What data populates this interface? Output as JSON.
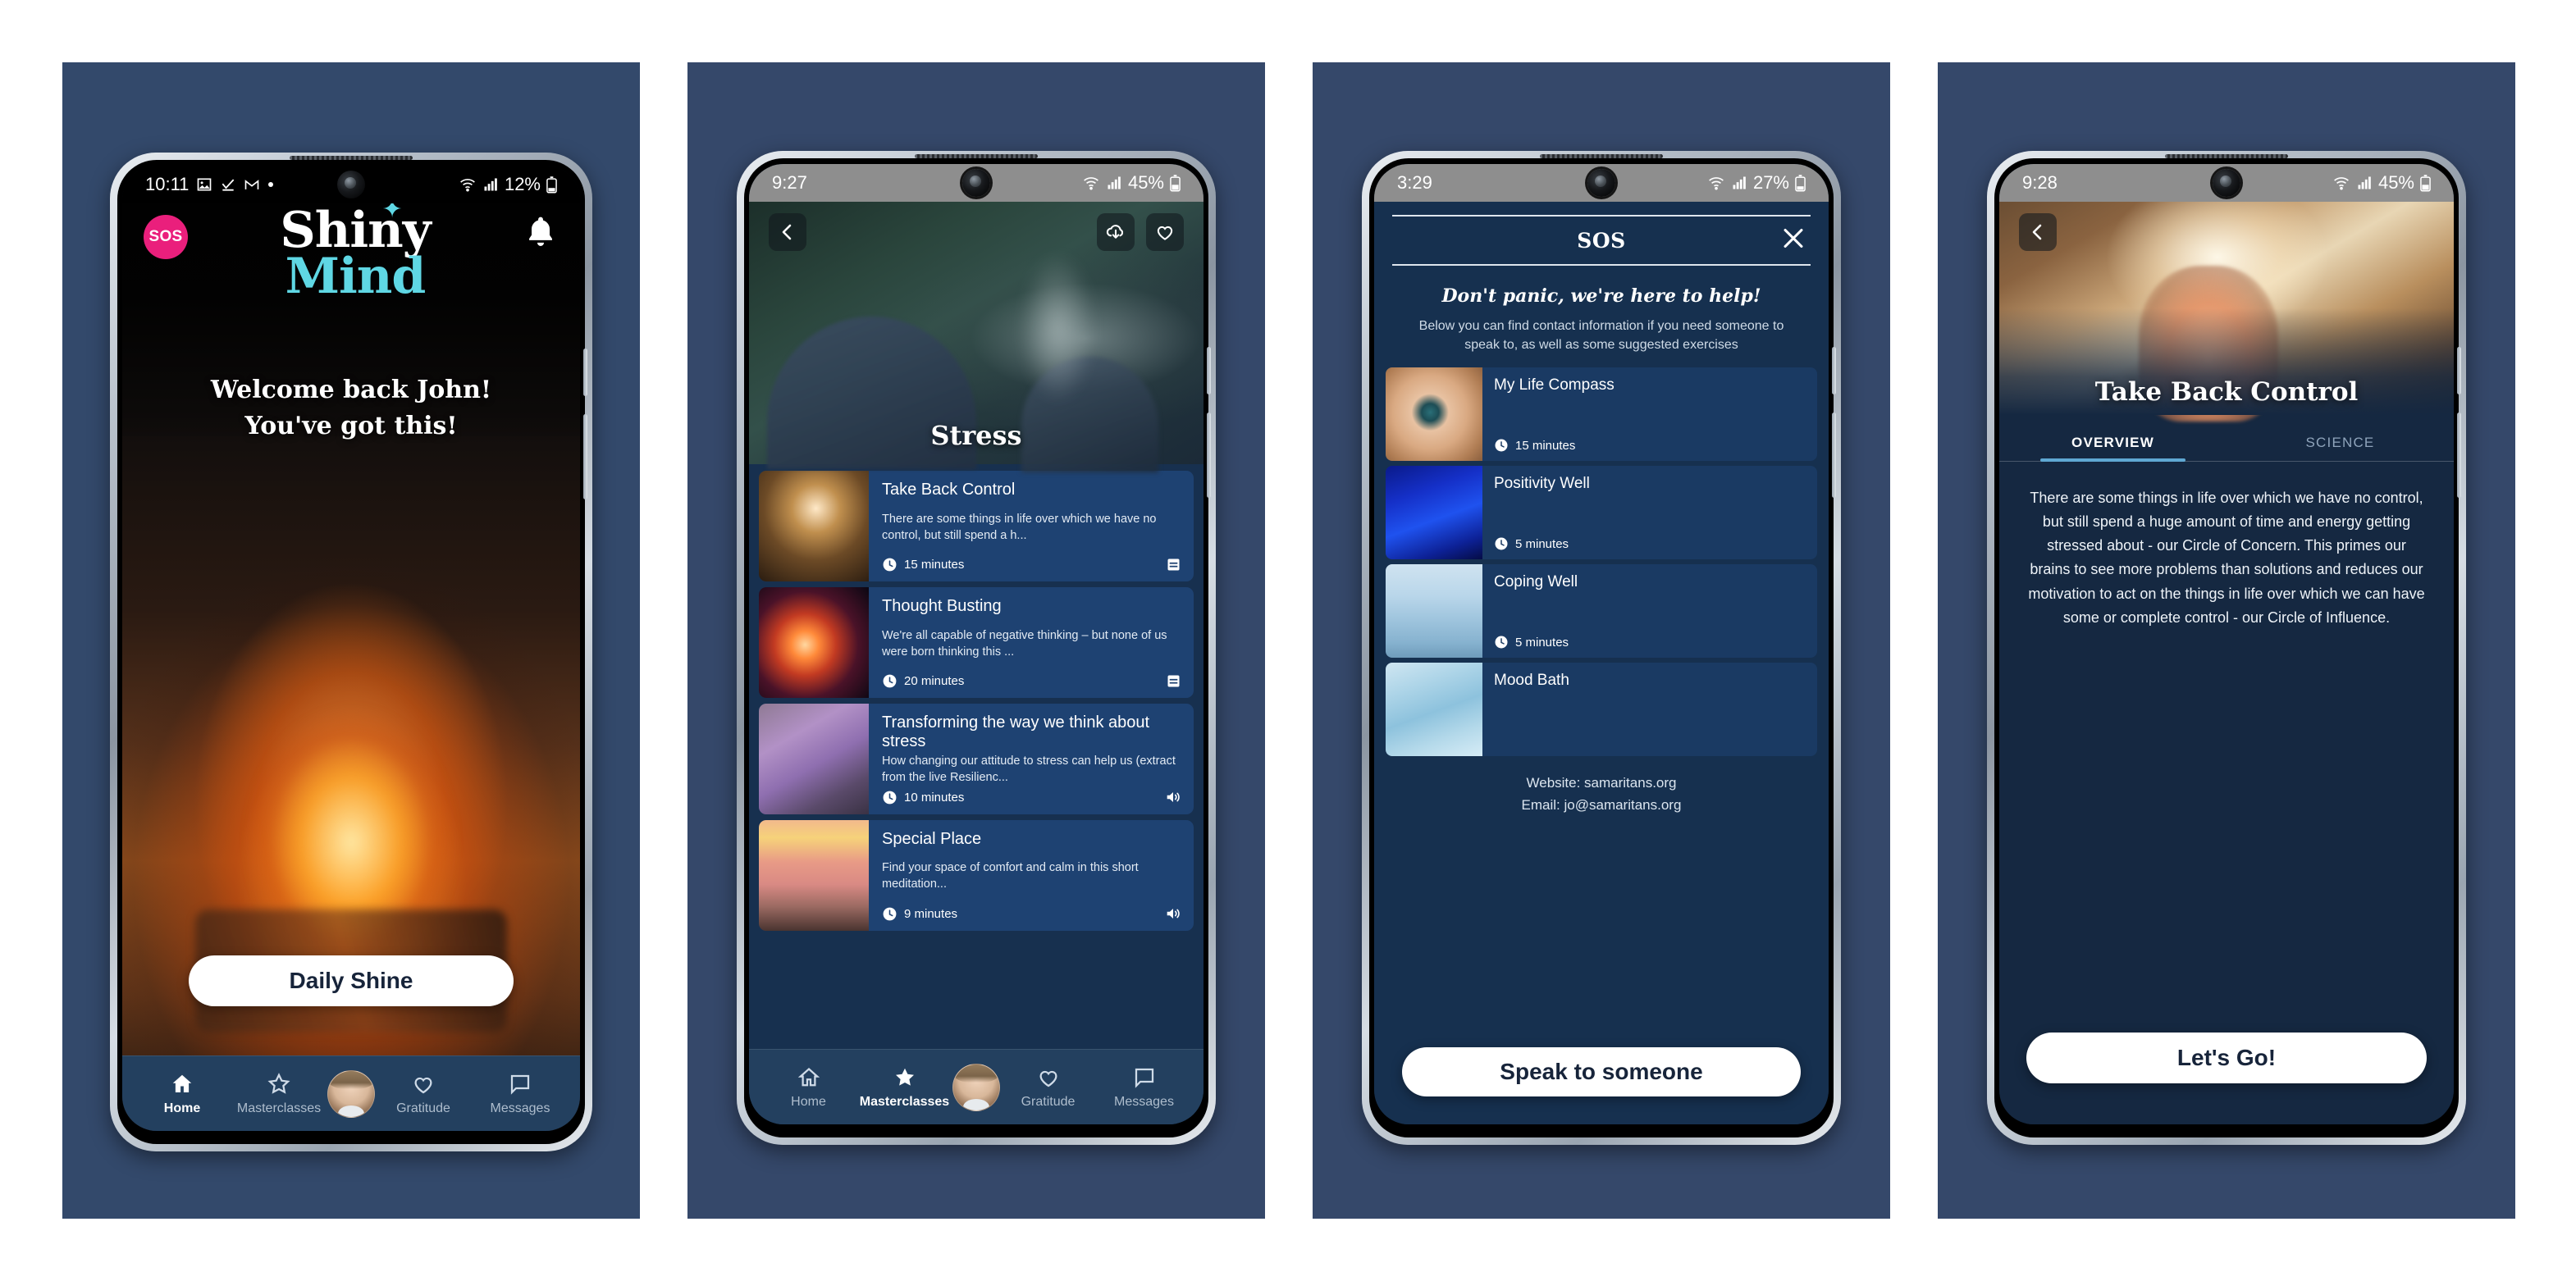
{
  "screens": [
    {
      "id": "home",
      "status": {
        "time": "10:11",
        "battery": "12%",
        "icons": [
          "image-icon",
          "check-icon",
          "gmail-icon",
          "dot-icon",
          "wifi-icon",
          "signal-icon",
          "battery-icon"
        ]
      },
      "sos_label": "SOS",
      "brand": {
        "line1": "Shiny",
        "line2": "Mind"
      },
      "welcome_line1": "Welcome back John!",
      "welcome_line2": "You've got this!",
      "cta_label": "Daily Shine",
      "nav": [
        {
          "label": "Home",
          "icon": "home-icon",
          "active": true
        },
        {
          "label": "Masterclasses",
          "icon": "star-icon",
          "active": false
        },
        {
          "label": "",
          "icon": "avatar",
          "active": false
        },
        {
          "label": "Gratitude",
          "icon": "heart-icon",
          "active": false
        },
        {
          "label": "Messages",
          "icon": "message-icon",
          "active": false
        }
      ]
    },
    {
      "id": "masterclass-list",
      "status": {
        "time": "9:27",
        "battery": "45%"
      },
      "back_icon": "chevron-left-icon",
      "download_icon": "cloud-download-icon",
      "favourite_icon": "heart-outline-icon",
      "hero_title": "Stress",
      "cards": [
        {
          "title": "Take Back Control",
          "desc": "There are some things in life over which we have no control, but still spend a h...",
          "duration": "15 minutes",
          "media": "document-icon",
          "thumb": "th-hand"
        },
        {
          "title": "Thought Busting",
          "desc": "We're all capable of negative thinking – but none of us were born thinking this ...",
          "duration": "20 minutes",
          "media": "document-icon",
          "thumb": "th-firework"
        },
        {
          "title": "Transforming the way we think about stress",
          "desc": "How changing our attitude to stress can help us (extract from the live Resilienc...",
          "duration": "10 minutes",
          "media": "audio-icon",
          "thumb": "th-butterfly"
        },
        {
          "title": "Special Place",
          "desc": "Find your space of comfort and calm in this short meditation...",
          "duration": "9 minutes",
          "media": "audio-icon",
          "thumb": "th-sunset"
        }
      ],
      "nav": [
        {
          "label": "Home",
          "icon": "home-icon",
          "active": false
        },
        {
          "label": "Masterclasses",
          "icon": "star-icon",
          "active": true
        },
        {
          "label": "",
          "icon": "avatar",
          "active": false
        },
        {
          "label": "Gratitude",
          "icon": "heart-icon",
          "active": false
        },
        {
          "label": "Messages",
          "icon": "message-icon",
          "active": false
        }
      ]
    },
    {
      "id": "sos-modal",
      "status": {
        "time": "3:29",
        "battery": "27%"
      },
      "title": "SOS",
      "close_icon": "close-icon",
      "lead": "Don't panic, we're here to help!",
      "sub": "Below you can find contact information if you need someone to speak to, as well as some suggested exercises",
      "cards": [
        {
          "title": "My Life Compass",
          "duration": "15 minutes",
          "thumb": "th-compass"
        },
        {
          "title": "Positivity Well",
          "duration": "5 minutes",
          "thumb": "th-neon"
        },
        {
          "title": "Coping Well",
          "duration": "5 minutes",
          "thumb": "th-ladder"
        },
        {
          "title": "Mood Bath",
          "duration": "",
          "thumb": "th-water"
        }
      ],
      "website": "Website: samaritans.org",
      "email": "Email: jo@samaritans.org",
      "cta_label": "Speak to someone"
    },
    {
      "id": "masterclass-detail",
      "status": {
        "time": "9:28",
        "battery": "45%"
      },
      "back_icon": "chevron-left-icon",
      "title": "Take Back Control",
      "tabs": [
        {
          "label": "OVERVIEW",
          "active": true
        },
        {
          "label": "SCIENCE",
          "active": false
        }
      ],
      "body": "There are some things in life over which we have no control, but still spend a huge amount of time and energy getting stressed about - our Circle of Concern. This primes our brains to see more problems than solutions and reduces our motivation to act on the things in life over which we can have some or complete control - our Circle of Influence.",
      "cta_label": "Let's Go!"
    }
  ],
  "colors": {
    "panel_bg": "#35486a",
    "accent_pink": "#ea1f7c",
    "brand_cyan": "#5fd7e4",
    "nav_bg": "#23405f",
    "card_blue": "#1e4272",
    "sos_card_blue": "#1a3a63",
    "tab_underline": "#5fa8d3"
  }
}
